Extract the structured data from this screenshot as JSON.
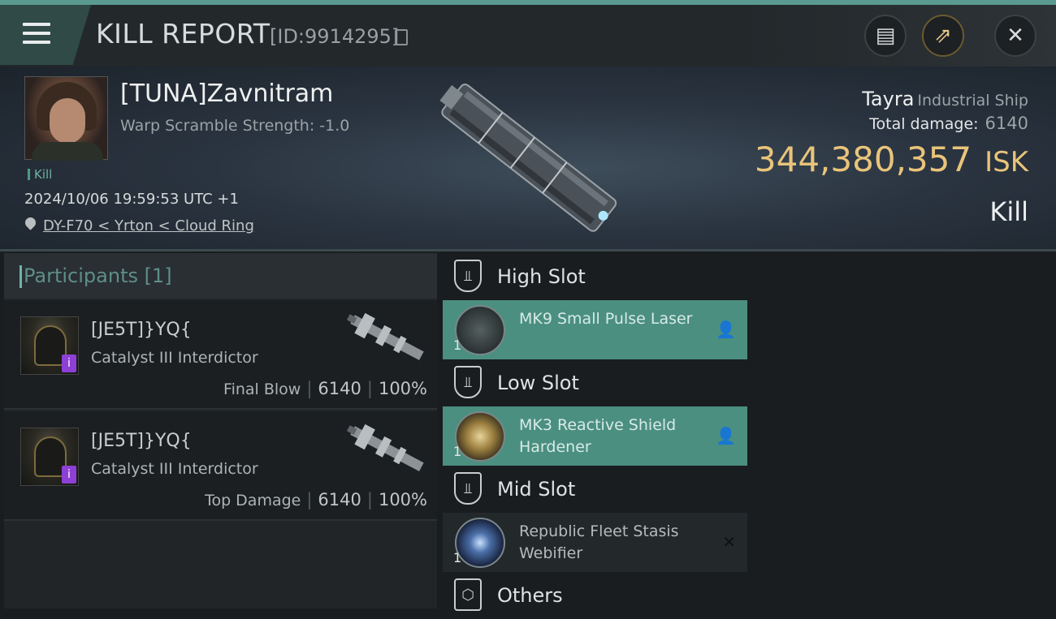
{
  "header": {
    "title": "KILL REPORT",
    "report_id": "[ID:9914295]",
    "copy_icon": "copy-icon",
    "clipboard_icon": "clipboard-icon",
    "share_icon": "share-icon",
    "close_icon": "close-icon"
  },
  "victim": {
    "name": "[TUNA]Zavnitram",
    "warp_scramble": "Warp Scramble Strength: -1.0",
    "tag": "Kill",
    "timestamp": "2024/10/06 19:59:53 UTC +1",
    "location": "DY-F70 < Yrton < Cloud Ring",
    "ship_name": "Tayra",
    "ship_class": "Industrial Ship",
    "total_damage_label": "Total damage:",
    "total_damage": "6140",
    "isk_value": "344,380,357",
    "isk_unit": "ISK",
    "result": "Kill",
    "accent_color": "#e9c47a"
  },
  "participants": {
    "header": "Participants [1]",
    "rows": [
      {
        "name": "[JE5T]}YQ{",
        "ship": "Catalyst III Interdictor",
        "role": "Final Blow",
        "damage": "6140",
        "percent": "100%",
        "badge": "i"
      },
      {
        "name": "[JE5T]}YQ{",
        "ship": "Catalyst III Interdictor",
        "role": "Top Damage",
        "damage": "6140",
        "percent": "100%",
        "badge": "i"
      }
    ]
  },
  "slots": {
    "high": {
      "title": "High Slot",
      "module": {
        "qty": "1",
        "name": "MK9 Small Pulse Laser",
        "state": "dropped-fitted"
      }
    },
    "low": {
      "title": "Low Slot",
      "module": {
        "qty": "1",
        "name": "MK3 Reactive Shield Hardener",
        "state": "dropped-fitted"
      }
    },
    "mid": {
      "title": "Mid Slot",
      "module": {
        "qty": "1",
        "name": "Republic Fleet Stasis Webifier",
        "state": "destroyed"
      }
    },
    "others": {
      "title": "Others"
    }
  }
}
